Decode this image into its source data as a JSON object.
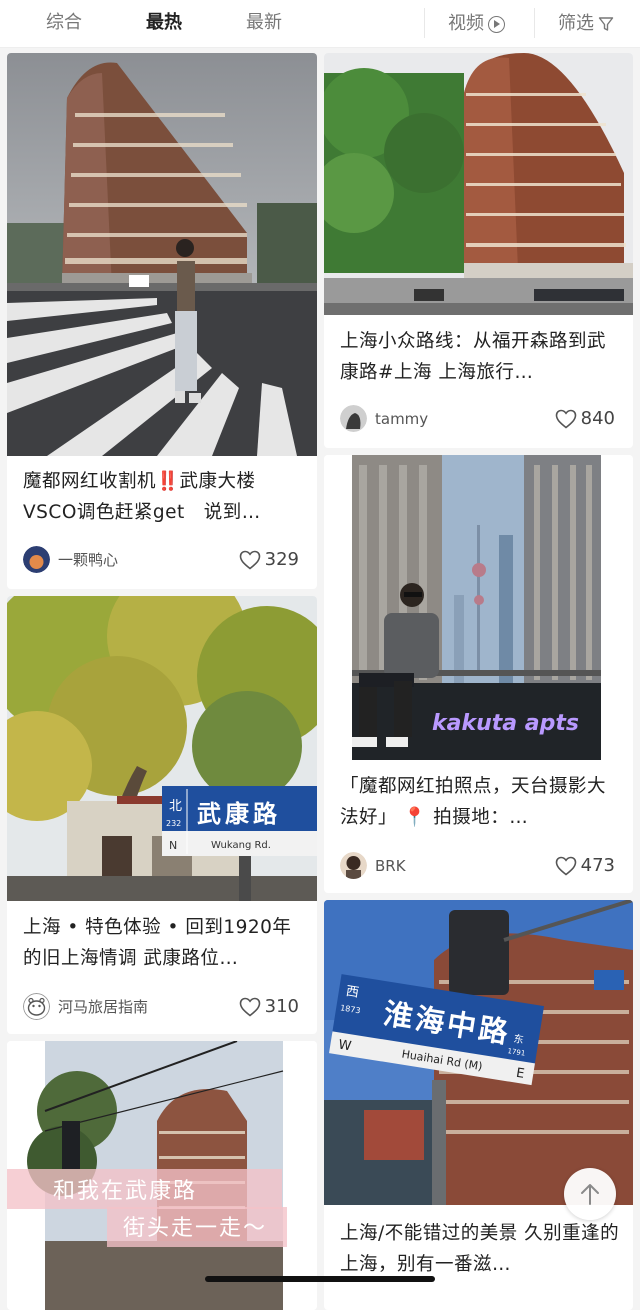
{
  "tabs": [
    {
      "label": "综合",
      "active": false
    },
    {
      "label": "最热",
      "active": true
    },
    {
      "label": "最新",
      "active": false
    }
  ],
  "video_label": "视频",
  "filter_label": "筛选",
  "icons": {
    "video": "play-circle-icon",
    "filter": "funnel-icon",
    "like": "heart-outline-icon",
    "scroll_top": "arrow-up-icon"
  },
  "colors": {
    "active_tab": "#222222",
    "inactive_tab": "#777777",
    "background": "#f4f4f4",
    "card": "#ffffff"
  },
  "cards": [
    {
      "title": "魔都网红收割机‼️武康大楼VSCO调色赶紧get　说到…",
      "author": "一颗鸭心",
      "likes": "329"
    },
    {
      "title": "上海小众路线：从福开森路到武康路#上海 上海旅行…",
      "author": "tammy",
      "likes": "840"
    },
    {
      "title": "上海 • 特色体验 • 回到1920年的旧上海情调 武康路位…",
      "author": "河马旅居指南",
      "likes": "310"
    },
    {
      "title": "「魔都网红拍照点，天台摄影大法好」 📍 拍摄地：…",
      "author": "BRK",
      "likes": "473",
      "photo_text": "kakuta apts"
    },
    {
      "title": "",
      "author": "",
      "likes": "",
      "photo_text_line1": "和我在武康路",
      "photo_text_line2": "街头走一走～"
    },
    {
      "title": "上海/不能错过的美景 久别重逢的上海，别有一番滋…",
      "author": "",
      "likes": ""
    }
  ],
  "signs": {
    "wukang_dir": "北",
    "wukang_num": "232",
    "wukang_cn": "武康路",
    "wukang_n": "N",
    "wukang_en": "Wukang Rd.",
    "huaihai_dir": "西",
    "huaihai_num": "1873",
    "huaihai_cn": "淮海中路",
    "huaihai_w": "W",
    "huaihai_en": "Huaihai Rd (M)",
    "huaihai_e": "E",
    "huaihai_east": "东",
    "huaihai_num2": "1791"
  }
}
